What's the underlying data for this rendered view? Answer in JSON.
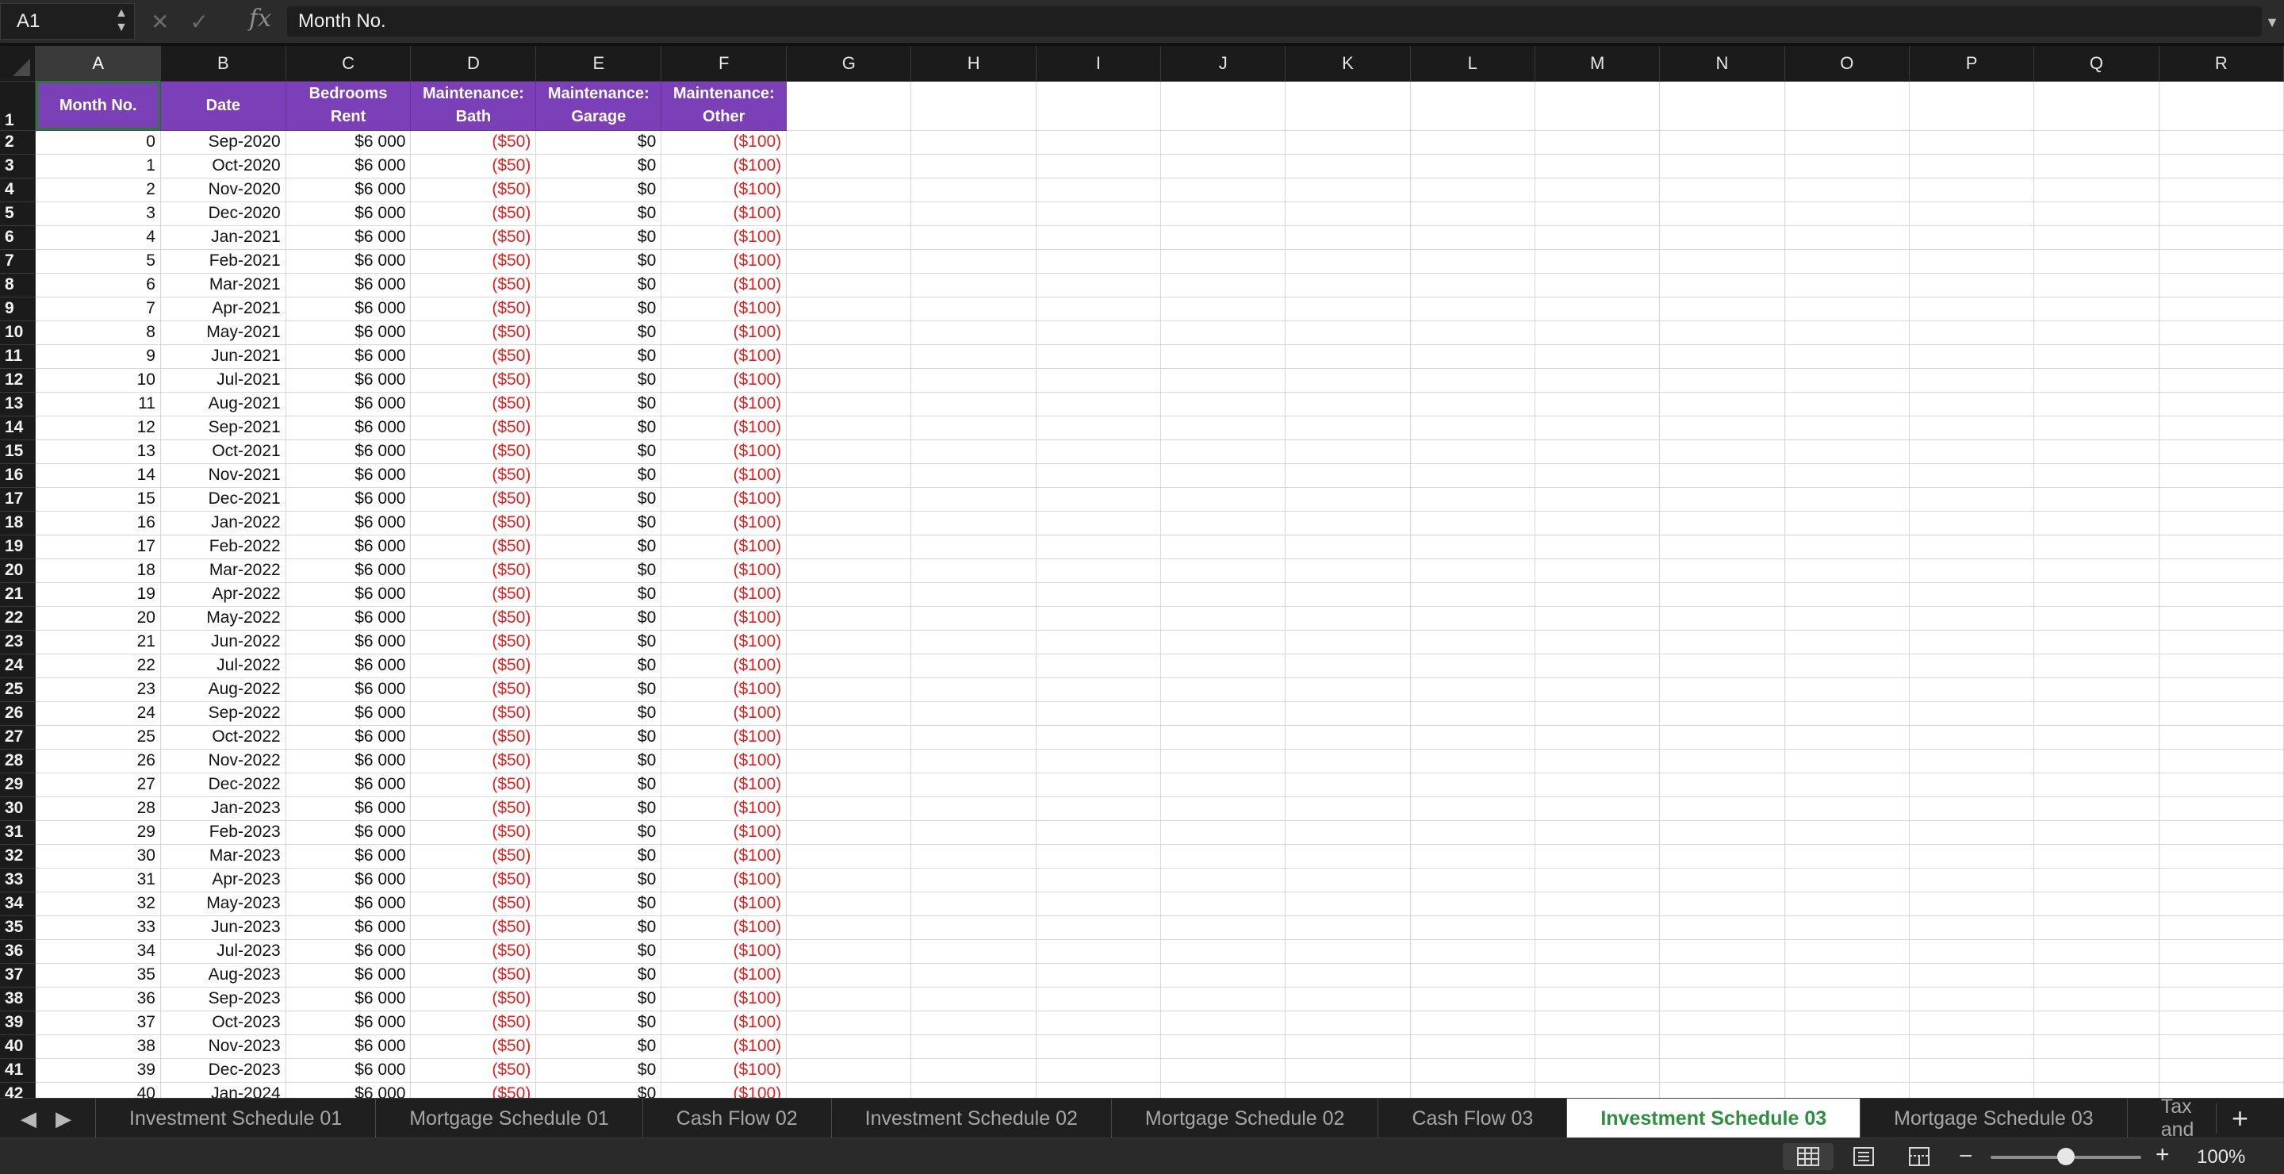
{
  "formula_bar": {
    "name_box": "A1",
    "stepper": "▲▼",
    "cancel_icon": "✕",
    "confirm_icon": "✓",
    "fx_label": "fx",
    "formula_value": "Month No.",
    "dropdown_icon": "▼"
  },
  "grid": {
    "columns": [
      "A",
      "B",
      "C",
      "D",
      "E",
      "F",
      "G",
      "H",
      "I",
      "J",
      "K",
      "L",
      "M",
      "N",
      "O",
      "P",
      "Q",
      "R"
    ],
    "selected_column": "A",
    "header_row": [
      "Month No.",
      "Date",
      "Bedrooms Rent",
      "Maintenance: Bath",
      "Maintenance: Garage",
      "Maintenance: Other"
    ],
    "rows": [
      [
        "0",
        "Sep-2020",
        "$6 000",
        "($50)",
        "$0",
        "($100)"
      ],
      [
        "1",
        "Oct-2020",
        "$6 000",
        "($50)",
        "$0",
        "($100)"
      ],
      [
        "2",
        "Nov-2020",
        "$6 000",
        "($50)",
        "$0",
        "($100)"
      ],
      [
        "3",
        "Dec-2020",
        "$6 000",
        "($50)",
        "$0",
        "($100)"
      ],
      [
        "4",
        "Jan-2021",
        "$6 000",
        "($50)",
        "$0",
        "($100)"
      ],
      [
        "5",
        "Feb-2021",
        "$6 000",
        "($50)",
        "$0",
        "($100)"
      ],
      [
        "6",
        "Mar-2021",
        "$6 000",
        "($50)",
        "$0",
        "($100)"
      ],
      [
        "7",
        "Apr-2021",
        "$6 000",
        "($50)",
        "$0",
        "($100)"
      ],
      [
        "8",
        "May-2021",
        "$6 000",
        "($50)",
        "$0",
        "($100)"
      ],
      [
        "9",
        "Jun-2021",
        "$6 000",
        "($50)",
        "$0",
        "($100)"
      ],
      [
        "10",
        "Jul-2021",
        "$6 000",
        "($50)",
        "$0",
        "($100)"
      ],
      [
        "11",
        "Aug-2021",
        "$6 000",
        "($50)",
        "$0",
        "($100)"
      ],
      [
        "12",
        "Sep-2021",
        "$6 000",
        "($50)",
        "$0",
        "($100)"
      ],
      [
        "13",
        "Oct-2021",
        "$6 000",
        "($50)",
        "$0",
        "($100)"
      ],
      [
        "14",
        "Nov-2021",
        "$6 000",
        "($50)",
        "$0",
        "($100)"
      ],
      [
        "15",
        "Dec-2021",
        "$6 000",
        "($50)",
        "$0",
        "($100)"
      ],
      [
        "16",
        "Jan-2022",
        "$6 000",
        "($50)",
        "$0",
        "($100)"
      ],
      [
        "17",
        "Feb-2022",
        "$6 000",
        "($50)",
        "$0",
        "($100)"
      ],
      [
        "18",
        "Mar-2022",
        "$6 000",
        "($50)",
        "$0",
        "($100)"
      ],
      [
        "19",
        "Apr-2022",
        "$6 000",
        "($50)",
        "$0",
        "($100)"
      ],
      [
        "20",
        "May-2022",
        "$6 000",
        "($50)",
        "$0",
        "($100)"
      ],
      [
        "21",
        "Jun-2022",
        "$6 000",
        "($50)",
        "$0",
        "($100)"
      ],
      [
        "22",
        "Jul-2022",
        "$6 000",
        "($50)",
        "$0",
        "($100)"
      ],
      [
        "23",
        "Aug-2022",
        "$6 000",
        "($50)",
        "$0",
        "($100)"
      ],
      [
        "24",
        "Sep-2022",
        "$6 000",
        "($50)",
        "$0",
        "($100)"
      ],
      [
        "25",
        "Oct-2022",
        "$6 000",
        "($50)",
        "$0",
        "($100)"
      ],
      [
        "26",
        "Nov-2022",
        "$6 000",
        "($50)",
        "$0",
        "($100)"
      ],
      [
        "27",
        "Dec-2022",
        "$6 000",
        "($50)",
        "$0",
        "($100)"
      ],
      [
        "28",
        "Jan-2023",
        "$6 000",
        "($50)",
        "$0",
        "($100)"
      ],
      [
        "29",
        "Feb-2023",
        "$6 000",
        "($50)",
        "$0",
        "($100)"
      ],
      [
        "30",
        "Mar-2023",
        "$6 000",
        "($50)",
        "$0",
        "($100)"
      ],
      [
        "31",
        "Apr-2023",
        "$6 000",
        "($50)",
        "$0",
        "($100)"
      ],
      [
        "32",
        "May-2023",
        "$6 000",
        "($50)",
        "$0",
        "($100)"
      ],
      [
        "33",
        "Jun-2023",
        "$6 000",
        "($50)",
        "$0",
        "($100)"
      ],
      [
        "34",
        "Jul-2023",
        "$6 000",
        "($50)",
        "$0",
        "($100)"
      ],
      [
        "35",
        "Aug-2023",
        "$6 000",
        "($50)",
        "$0",
        "($100)"
      ],
      [
        "36",
        "Sep-2023",
        "$6 000",
        "($50)",
        "$0",
        "($100)"
      ],
      [
        "37",
        "Oct-2023",
        "$6 000",
        "($50)",
        "$0",
        "($100)"
      ],
      [
        "38",
        "Nov-2023",
        "$6 000",
        "($50)",
        "$0",
        "($100)"
      ],
      [
        "39",
        "Dec-2023",
        "$6 000",
        "($50)",
        "$0",
        "($100)"
      ],
      [
        "40",
        "Jan-2024",
        "$6 000",
        "($50)",
        "$0",
        "($100)"
      ]
    ],
    "row_numbers": [
      "1",
      "2",
      "3",
      "4",
      "5",
      "6",
      "7",
      "8",
      "9",
      "10",
      "11",
      "12",
      "13",
      "14",
      "15",
      "16",
      "17",
      "18",
      "19",
      "20",
      "21",
      "22",
      "23",
      "24",
      "25",
      "26",
      "27",
      "28",
      "29",
      "30",
      "31",
      "32",
      "33",
      "34",
      "35",
      "36",
      "37",
      "38",
      "39",
      "40",
      "41",
      "42"
    ],
    "colors": {
      "header_fill": "#7b3fb7",
      "negative_text": "#e02020"
    }
  },
  "sheet_tabs": {
    "prev_icon": "◀",
    "next_icon": "▶",
    "tabs": [
      {
        "label": "Investment Schedule 01"
      },
      {
        "label": "Mortgage Schedule 01"
      },
      {
        "label": "Cash Flow 02"
      },
      {
        "label": "Investment Schedule 02"
      },
      {
        "label": "Mortgage Schedule 02"
      },
      {
        "label": "Cash Flow 03"
      },
      {
        "label": "Investment Schedule 03"
      },
      {
        "label": "Mortgage Schedule 03"
      },
      {
        "label": "Tax and"
      }
    ],
    "active_tab": "Investment Schedule 03",
    "add_icon": "+"
  },
  "status_bar": {
    "views": [
      "normal-view-icon",
      "page-layout-icon",
      "page-break-icon"
    ],
    "zoom_minus": "−",
    "zoom_plus": "+",
    "zoom_level": "100%",
    "zoom_value": 0.5
  }
}
